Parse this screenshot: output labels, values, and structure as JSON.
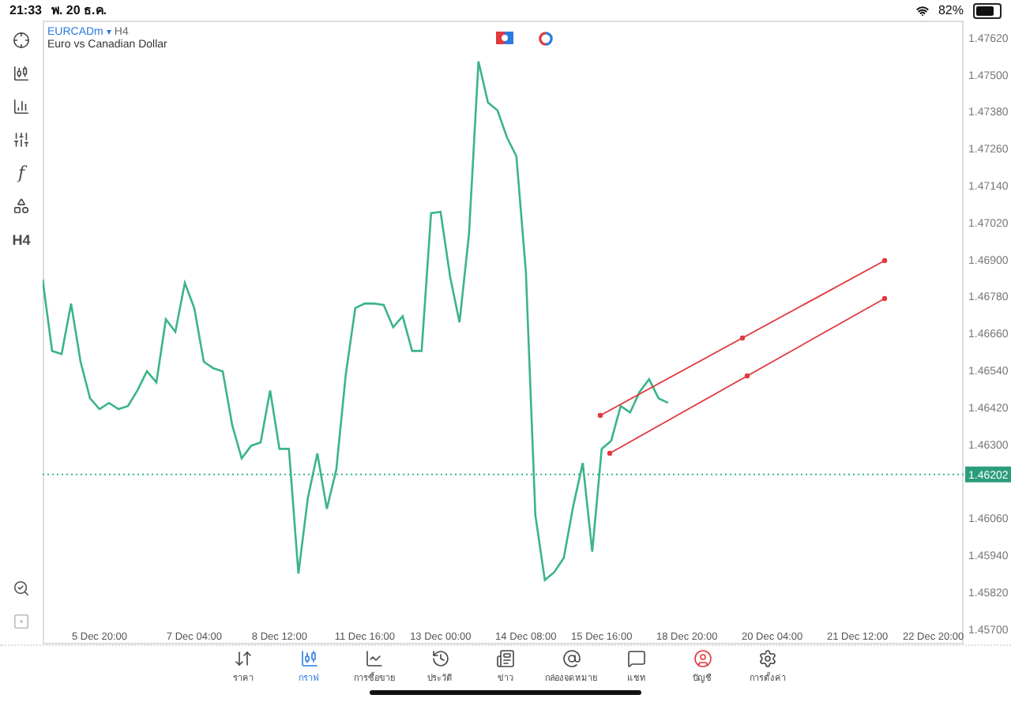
{
  "status_bar": {
    "time": "21:33",
    "date": "พ. 20 ธ.ค.",
    "battery": "82%"
  },
  "toolbar": [
    {
      "kind": "icon"
    },
    {
      "kind": "icon"
    },
    {
      "kind": "icon"
    },
    {
      "kind": "icon"
    },
    {
      "kind": "text",
      "label": "f"
    },
    {
      "kind": "icon"
    },
    {
      "kind": "text",
      "label": "H4"
    }
  ],
  "toolbar_bottom": [
    {
      "kind": "icon"
    },
    {
      "kind": "icon"
    }
  ],
  "chart": {
    "symbol": "EURCADm",
    "caret": "▾",
    "timeframe": "H4",
    "description": "Euro vs Canadian Dollar",
    "chart_data": {
      "type": "line",
      "categories": [
        null,
        null,
        null,
        null,
        null,
        null,
        "5 Dec 20:00",
        null,
        null,
        null,
        null,
        null,
        null,
        null,
        null,
        null,
        "7 Dec 04:00",
        null,
        null,
        null,
        null,
        null,
        null,
        null,
        null,
        "8 Dec 12:00",
        null,
        null,
        null,
        null,
        null,
        null,
        null,
        null,
        "11 Dec 16:00",
        null,
        null,
        null,
        null,
        null,
        null,
        null,
        "13 Dec 00:00",
        null,
        null,
        null,
        null,
        null,
        null,
        null,
        null,
        "14 Dec 08:00",
        null,
        null,
        null,
        null,
        null,
        null,
        null,
        "15 Dec 16:00",
        null,
        null,
        null,
        null,
        null,
        null,
        null,
        null,
        "18 Dec 20:00",
        null,
        null,
        null,
        null,
        null,
        null,
        null,
        null,
        "20 Dec 04:00",
        null,
        null,
        null,
        null,
        null,
        null,
        null,
        null,
        "21 Dec 12:00",
        null,
        null,
        null,
        null,
        null,
        null,
        null,
        "22 Dec 20:00",
        null,
        null,
        null
      ],
      "series": [
        {
          "color": "#3bb586",
          "values": [
            1.46835,
            1.46603,
            1.46593,
            1.46757,
            1.46568,
            1.46449,
            1.46414,
            1.46434,
            1.46414,
            1.46424,
            1.46475,
            1.46537,
            1.46501,
            1.46706,
            1.46665,
            1.46824,
            1.46742,
            1.46568,
            1.46547,
            1.46537,
            1.46362,
            1.46254,
            1.46295,
            1.46306,
            1.46475,
            1.46285,
            1.46285,
            1.4588,
            1.46126,
            1.4627,
            1.4609,
            1.46218,
            1.46527,
            1.46742,
            1.46757,
            1.46757,
            1.46752,
            1.4668,
            1.46716,
            1.46603,
            1.46603,
            1.4705,
            1.47055,
            1.46845,
            1.46696,
            1.46983,
            1.47543,
            1.4741,
            1.47384,
            1.47297,
            1.47235,
            1.4686,
            1.4607,
            1.45859,
            1.45885,
            1.45931,
            1.461,
            1.46239,
            1.45951,
            1.46285,
            1.46311,
            1.46424,
            1.46403,
            1.4647,
            1.46511,
            1.46449,
            1.46434,
            null,
            null,
            null,
            null,
            null,
            null,
            null,
            null,
            null,
            null,
            null,
            null,
            null,
            null,
            null,
            null,
            null,
            null,
            null,
            null,
            null,
            null,
            null,
            null,
            null,
            null,
            null,
            null,
            null,
            null,
            null
          ]
        }
      ],
      "ylim": [
        1.4565,
        1.47676
      ],
      "ref_lines": [
        {
          "axis": "y",
          "value": 1.46202,
          "label": "1.46202"
        }
      ],
      "yticks": [
        {
          "value": 1.4762,
          "label": "1.47620"
        },
        {
          "value": 1.475,
          "label": "1.47500"
        },
        {
          "value": 1.4738,
          "label": "1.47380"
        },
        {
          "value": 1.4726,
          "label": "1.47260"
        },
        {
          "value": 1.4714,
          "label": "1.47140"
        },
        {
          "value": 1.4702,
          "label": "1.47020"
        },
        {
          "value": 1.469,
          "label": "1.46900"
        },
        {
          "value": 1.4678,
          "label": "1.46780"
        },
        {
          "value": 1.4666,
          "label": "1.46660"
        },
        {
          "value": 1.4654,
          "label": "1.46540"
        },
        {
          "value": 1.4642,
          "label": "1.46420"
        },
        {
          "value": 1.463,
          "label": "1.46300"
        },
        {
          "value": 1.4606,
          "label": "1.46060"
        },
        {
          "value": 1.4594,
          "label": "1.45940"
        },
        {
          "value": 1.4582,
          "label": "1.45820"
        },
        {
          "value": 1.457,
          "label": "1.45700"
        }
      ]
    }
  },
  "tabs": [
    {
      "label": "ราคา",
      "selected": false
    },
    {
      "label": "กราฟ",
      "selected": true
    },
    {
      "label": "การซื้อขาย",
      "selected": false
    },
    {
      "label": "ประวัติ",
      "selected": false
    },
    {
      "label": "ข่าว",
      "selected": false
    },
    {
      "label": "กล่องจดหมาย",
      "selected": false
    },
    {
      "label": "แชท",
      "selected": false
    },
    {
      "label": "บัญชี",
      "selected": false,
      "color": "#e0393e"
    },
    {
      "label": "การตั้งค่า",
      "selected": false
    }
  ]
}
